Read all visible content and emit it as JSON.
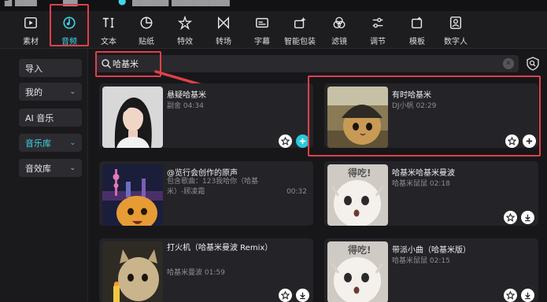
{
  "toolbar": {
    "items": [
      {
        "label": "素材",
        "icon": "media-icon"
      },
      {
        "label": "音频",
        "icon": "audio-icon"
      },
      {
        "label": "文本",
        "icon": "text-icon"
      },
      {
        "label": "贴纸",
        "icon": "sticker-icon"
      },
      {
        "label": "特效",
        "icon": "effects-icon"
      },
      {
        "label": "转场",
        "icon": "transition-icon"
      },
      {
        "label": "字幕",
        "icon": "subtitle-icon"
      },
      {
        "label": "智能包装",
        "icon": "smart-pack-icon"
      },
      {
        "label": "滤镜",
        "icon": "filter-icon"
      },
      {
        "label": "调节",
        "icon": "adjust-icon"
      },
      {
        "label": "模板",
        "icon": "template-icon"
      },
      {
        "label": "数字人",
        "icon": "digital-human-icon"
      }
    ],
    "active": "音频",
    "accent": "#3fd5e8"
  },
  "sidebar": {
    "items": [
      {
        "label": "导入"
      },
      {
        "label": "我的"
      },
      {
        "label": "AI 音乐"
      },
      {
        "label": "音乐库"
      },
      {
        "label": "音效库"
      }
    ]
  },
  "search": {
    "value": "哈基米"
  },
  "results": [
    {
      "title": "悬疑哈基米",
      "subtitle": "副舍 04:34",
      "duration": ""
    },
    {
      "title": "有时哈基米",
      "subtitle": "DJ小帆 02:29",
      "duration": ""
    },
    {
      "title": "@览行会创作的原声",
      "subtitle": "包含歌曲：123我哈你（哈基米）-顾凌霜",
      "duration": "00:32"
    },
    {
      "title": "哈基米哈基米曼波",
      "subtitle": "哈基米鼠鼠 02:18",
      "duration": ""
    },
    {
      "title": "打火机（哈基米曼波 Remix）",
      "subtitle": "哈基米曼波 01:59",
      "duration": ""
    },
    {
      "title": "带派小曲（哈基米版）",
      "subtitle": "哈基米鼠鼠 02:15",
      "duration": ""
    }
  ],
  "meme_text": "得吃!",
  "colors": {
    "highlight": "#e04049",
    "add_button": "#28c9dd"
  }
}
